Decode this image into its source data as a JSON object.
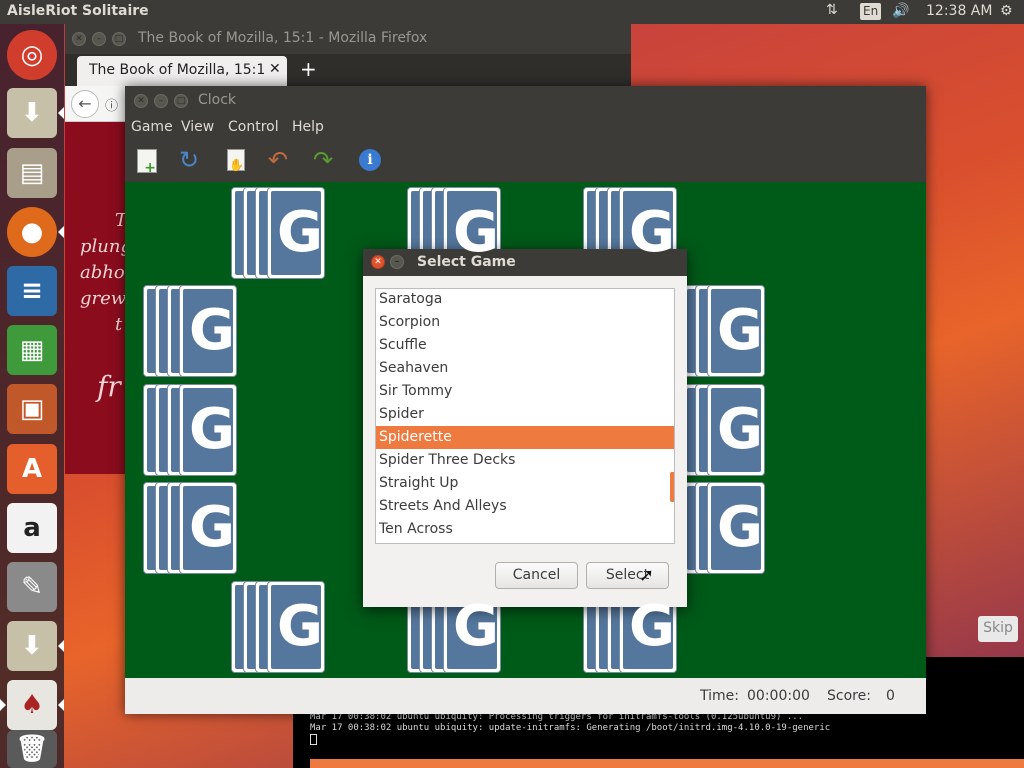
{
  "topbar": {
    "app_title": "AisleRiot Solitaire",
    "keyboard_layout": "En",
    "time": "12:38 AM"
  },
  "launcher": {
    "items": [
      {
        "name": "ubuntu-dash-icon"
      },
      {
        "name": "installer-icon"
      },
      {
        "name": "files-icon"
      },
      {
        "name": "firefox-icon"
      },
      {
        "name": "writer-icon"
      },
      {
        "name": "calc-icon"
      },
      {
        "name": "impress-icon"
      },
      {
        "name": "software-center-icon"
      },
      {
        "name": "amazon-icon"
      },
      {
        "name": "system-settings-icon"
      },
      {
        "name": "installer-icon"
      },
      {
        "name": "solitaire-icon"
      },
      {
        "name": "trash-icon"
      }
    ]
  },
  "firefox": {
    "window_title": "The Book of Mozilla, 15:1 - Mozilla Firefox",
    "tab_label": "The Book of Mozilla, 15:1",
    "new_tab": "+",
    "body_fragments": [
      "T",
      "plung",
      "abhor",
      "grew",
      "t",
      "fr"
    ]
  },
  "clock": {
    "window_title": "Clock",
    "menu": [
      "Game",
      "View",
      "Control",
      "Help"
    ],
    "status": {
      "time_label": "Time:",
      "time_value": "00:00:00",
      "score_label": "Score:",
      "score_value": "0"
    }
  },
  "dialog": {
    "title": "Select Game",
    "games": [
      "Saratoga",
      "Scorpion",
      "Scuffle",
      "Seahaven",
      "Sir Tommy",
      "Spider",
      "Spiderette",
      "Spider Three Decks",
      "Straight Up",
      "Streets And Alleys",
      "Ten Across"
    ],
    "selected": "Spiderette",
    "cancel_label": "Cancel",
    "select_label": "Select"
  },
  "installer": {
    "skip_label": "Skip",
    "log_lines": [
      "Mar 17 00:38:02 ubuntu ubiquity: Processing triggers for initramfs-tools (0.125ubuntu9) ...",
      "Mar 17 00:38:02 ubuntu ubiquity: update-initramfs: Generating /boot/initrd.img-4.10.0-19-generic"
    ]
  },
  "colors": {
    "accent": "#ef7a3f",
    "felt": "#005a18",
    "card_back": "#55779e",
    "firefox_page": "#8a0c1d"
  }
}
